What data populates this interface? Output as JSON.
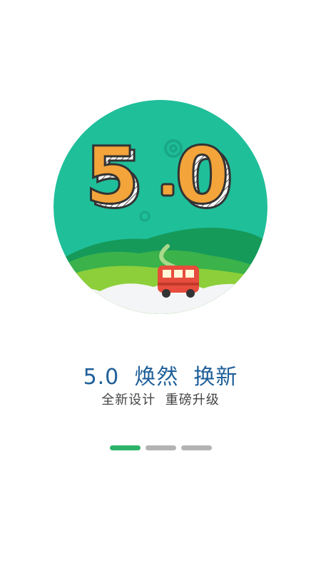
{
  "hero": {
    "version_art_text": "5.0",
    "colors": {
      "circle": "#1fbf9a",
      "digit_fill": "#f3a43a",
      "bus": "#e74c3c"
    }
  },
  "onboarding": {
    "headline": "5.0  焕然  换新",
    "subline": "全新设计  重磅升级"
  },
  "pager": {
    "pages": 3,
    "active_index": 0,
    "active_color": "#2eb36a",
    "inactive_color": "#b3b3b3"
  }
}
